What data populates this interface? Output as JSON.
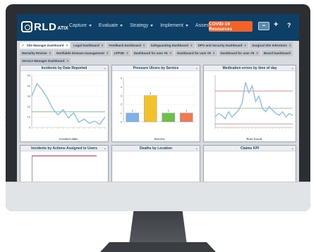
{
  "app": {
    "logo_text": "RLD",
    "logo_suffix": "ATIX"
  },
  "nav": {
    "items": [
      {
        "label": "Capture"
      },
      {
        "label": "Evaluate"
      },
      {
        "label": "Strategy"
      },
      {
        "label": "Implement"
      },
      {
        "label": "Assess"
      }
    ],
    "covid_button": "COVID-19 Resources",
    "plus_icon": "plus-icon",
    "help_icon": "help-icon"
  },
  "tabs": [
    {
      "label": "Site Manager Dashboard",
      "active": true
    },
    {
      "label": "Legal Dashboard"
    },
    {
      "label": "Feedback Dashboard"
    },
    {
      "label": "Safeguarding Dashboard"
    },
    {
      "label": "DPO and Security Dashboard"
    },
    {
      "label": "Surgical Site Infections"
    },
    {
      "label": "Mortality Review"
    },
    {
      "label": "Notifiable Disease management"
    },
    {
      "label": "LFPSE"
    },
    {
      "label": "Dashboard for user #6"
    },
    {
      "label": "Dashboard for user #6"
    },
    {
      "label": "Dashboard for user #6"
    },
    {
      "label": "Board Dashboard",
      "no_close": true
    },
    {
      "label": "Service Manager Dashboard"
    }
  ],
  "panels": {
    "incidents_by_date": {
      "title": "Incidents by Date Reported",
      "xlabel": "Incident date"
    },
    "pressure_ulcers": {
      "title": "Pressure Ulcers by Service",
      "xlabel": "Service"
    },
    "medication_errors": {
      "title": "Medication errors by time of day",
      "xlabel": "Time found"
    },
    "incidents_by_actions": {
      "title": "Incidents by Actions Assigned to Users"
    },
    "deaths_by_location": {
      "title": "Deaths by Location"
    },
    "claims_kpi": {
      "title": "Claims KPI"
    }
  },
  "colors": {
    "nav": "#0e3f66",
    "covid": "#f0632a",
    "line": "#8cc0e8",
    "mean_line": "#6cc06c",
    "limit_line": "#e04b4b"
  },
  "chart_data": [
    {
      "type": "line",
      "title": "Incidents by Date Reported",
      "xlabel": "Incident date",
      "ylim": [
        0,
        50
      ],
      "yticks": [
        0,
        10,
        20,
        30,
        40,
        50
      ],
      "mean": 15,
      "values": [
        30,
        42,
        36,
        28,
        18,
        12,
        17,
        9,
        14,
        5,
        8,
        4,
        6,
        3,
        10
      ]
    },
    {
      "type": "bar",
      "title": "Pressure Ulcers by Service",
      "xlabel": "Service",
      "ylim": [
        0,
        5
      ],
      "yticks": [
        0,
        1,
        2,
        3,
        4,
        5
      ],
      "values": [
        1,
        3,
        1,
        1
      ],
      "data_labels": [
        "1",
        "3",
        "1",
        "1"
      ],
      "colors": [
        "#7fb2e6",
        "#f2c12e",
        "#6cbf4a",
        "#f07b50"
      ]
    },
    {
      "type": "line",
      "title": "Medication errors by time of day",
      "xlabel": "Time found",
      "values": [
        6,
        8,
        7,
        5,
        9,
        6,
        8,
        10,
        14,
        26,
        20,
        24,
        15,
        18,
        11,
        9,
        12,
        10,
        8,
        7,
        9,
        6,
        8,
        7
      ],
      "ylim": [
        0,
        30
      ],
      "mean": 11,
      "ucl": 21,
      "lcl": 2
    }
  ]
}
